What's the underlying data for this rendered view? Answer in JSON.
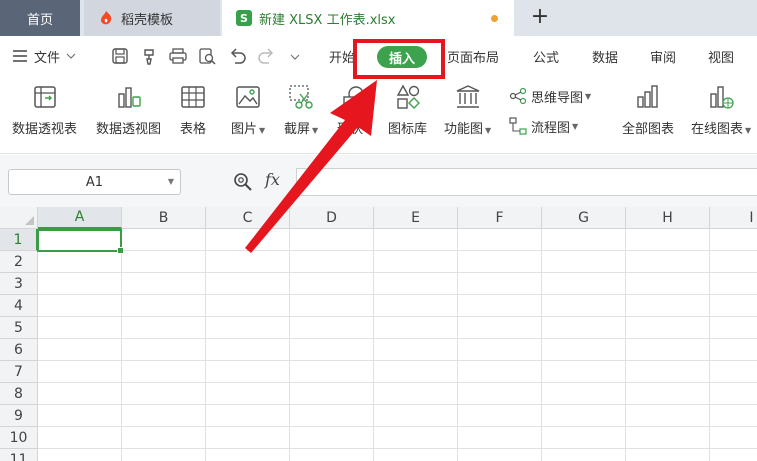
{
  "tabs": {
    "home_label": "首页",
    "template_label": "稻壳模板",
    "file_label": "新建 XLSX 工作表.xlsx",
    "file_icon_letter": "S",
    "new_tab_symbol": "+"
  },
  "menu": {
    "file_label": "文件",
    "tabs": [
      "开始",
      "插入",
      "页面布局",
      "公式",
      "数据",
      "审阅",
      "视图"
    ]
  },
  "ribbon": {
    "pivot_table": "数据透视表",
    "pivot_chart": "数据透视图",
    "table": "表格",
    "picture": "图片",
    "screenshot": "截屏",
    "shape": "形状",
    "icon_library": "图标库",
    "function_chart": "功能图",
    "mind_map": "思维导图",
    "flow_chart": "流程图",
    "all_charts": "全部图表",
    "online_charts": "在线图表"
  },
  "formula_bar": {
    "cell_ref": "A1",
    "fx_label": "fx"
  },
  "grid": {
    "columns": [
      "A",
      "B",
      "C",
      "D",
      "E",
      "F",
      "G",
      "H",
      "I"
    ],
    "rows": [
      "1",
      "2",
      "3",
      "4",
      "5",
      "6",
      "7",
      "8",
      "9",
      "10",
      "11"
    ],
    "active_cell": "A1"
  },
  "colors": {
    "accent_green": "#3ca24d",
    "annotation_red": "#e5161e",
    "home_tab": "#5b6578"
  }
}
